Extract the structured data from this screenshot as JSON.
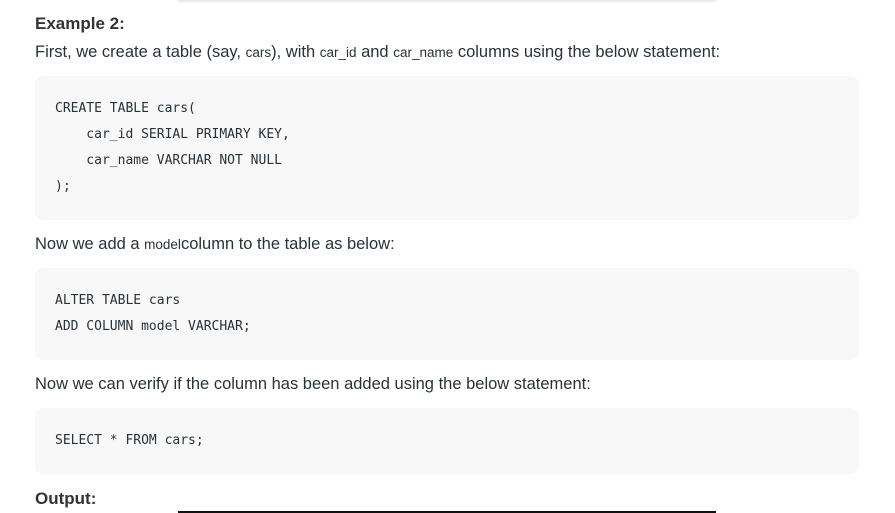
{
  "heading": "Example 2:",
  "para1": {
    "a": "First, we create a table (say, ",
    "c1": "cars",
    "b": "), with ",
    "c2": "car_id",
    "d": " and ",
    "c3": "car_name",
    "e": " columns using the below statement:"
  },
  "code1": [
    "CREATE TABLE cars(",
    "    car_id SERIAL PRIMARY KEY,",
    "    car_name VARCHAR NOT NULL",
    ");"
  ],
  "para2": {
    "a": "Now we add a ",
    "c1": "model",
    "b": "column to the table as below:"
  },
  "code2": [
    "ALTER TABLE cars",
    "ADD COLUMN model VARCHAR;"
  ],
  "para3": "Now we can verify if the column has been added using the below statement:",
  "code3": [
    "SELECT * FROM cars;"
  ],
  "output_label": "Output:"
}
